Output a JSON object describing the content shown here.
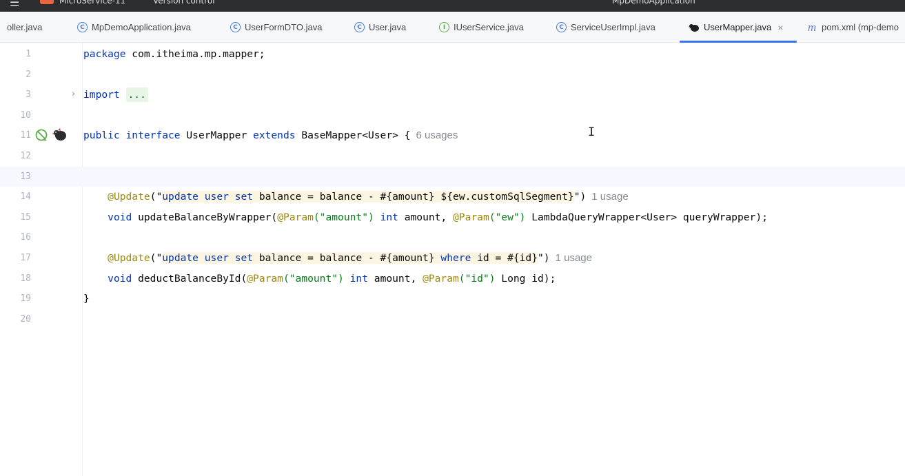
{
  "titlebar": {
    "menu_icon": "hamburger-menu-icon",
    "project": "MicroService-11",
    "vcs": "Version control",
    "run_config": "MpDemoApplication"
  },
  "tabs": [
    {
      "label": "oller.java",
      "icon": "class-icon"
    },
    {
      "label": "MpDemoApplication.java",
      "icon": "spring-boot-class-icon"
    },
    {
      "label": "UserFormDTO.java",
      "icon": "class-icon"
    },
    {
      "label": "User.java",
      "icon": "class-icon"
    },
    {
      "label": "IUserService.java",
      "icon": "interface-icon"
    },
    {
      "label": "ServiceUserImpl.java",
      "icon": "class-icon"
    },
    {
      "label": "UserMapper.java",
      "icon": "mybatis-bird-icon",
      "active": true,
      "close": "×"
    },
    {
      "label": "pom.xml (mp-demo",
      "icon": "maven-icon"
    }
  ],
  "editor": {
    "lines": {
      "l1": "1",
      "l2": "2",
      "l3": "3",
      "l10": "10",
      "l11": "11",
      "l12": "12",
      "l13": "13",
      "l14": "14",
      "l15": "15",
      "l16": "16",
      "l17": "17",
      "l18": "18",
      "l19": "19",
      "l20": "20"
    },
    "package_kw": "package",
    "package_name": " com.itheima.mp.mapper;",
    "import_kw": "import",
    "import_dots": "...",
    "public_kw": "public",
    "interface_kw": "interface",
    "class_name": " UserMapper ",
    "extends_kw": "extends",
    "base": " BaseMapper<User> {",
    "usages_11": "6 usages",
    "ann_update": "@Update",
    "l14_open": "(\"",
    "l14_sql": {
      "update": "update",
      "user": " user ",
      "set": "set",
      "rest": " balance = balance - #{amount} ${ew.customSqlSegment}"
    },
    "l14_close": "\")",
    "usages_14": "1 usage",
    "void_kw": "void",
    "l15_method": " updateBalanceByWrapper(",
    "param_ann": "@Param",
    "l15_p1": "(\"amount\")",
    "int_kw": "int",
    "l15_amount": " amount, ",
    "l15_p2": "(\"ew\")",
    "l15_rest": " LambdaQueryWrapper<User> queryWrapper);",
    "l17_open": "(\"",
    "l17_sql": {
      "update": "update",
      "user": " user ",
      "set": "set",
      "mid": " balance = balance - #{amount} ",
      "where": "where",
      "rest": " id = #{id}"
    },
    "l17_close": "\")",
    "usages_17": "1 usage",
    "l18_method": " deductBalanceById(",
    "l18_p1": "(\"amount\")",
    "l18_amount": " amount, ",
    "l18_p2": "(\"id\")",
    "l18_rest": " Long id);",
    "close_brace": "}"
  },
  "colors": {
    "keyword": "#0033b3",
    "annotation": "#9e880d",
    "string": "#067d17",
    "sql_bg": "#fbf5e2",
    "active_tab_underline": "#3574f0"
  }
}
